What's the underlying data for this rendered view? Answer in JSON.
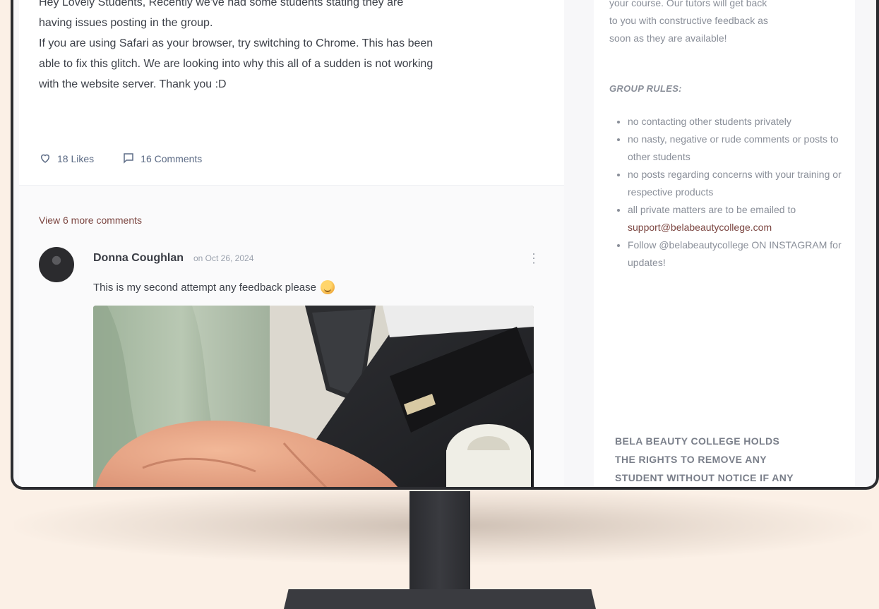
{
  "post": {
    "lines": [
      "Hey Lovely Students, Recently we've had some students stating they are",
      "having issues posting in the group.",
      "If you are using Safari as your browser, try switching to Chrome. This has been",
      "able to fix this glitch. We are looking into why this all of a sudden is not working",
      "with the website server. Thank you :D"
    ],
    "likes_label": "18 Likes",
    "comments_label": "16 Comments"
  },
  "comments": {
    "view_more_label": "View 6 more comments",
    "items": [
      {
        "author": "Donna Coughlan",
        "date": "on Oct 26, 2024",
        "text": "This is my second attempt any feedback please"
      }
    ]
  },
  "sidebar": {
    "intro_lines": [
      "your course. Our tutors will get back",
      "to you with constructive feedback as",
      "soon as they are available!"
    ],
    "rules_heading": "GROUP RULES:",
    "rules": [
      "no contacting other students privately",
      "no nasty, negative or rude comments or posts to other students",
      "no posts regarding concerns with your training or respective products",
      "all private matters are to be emailed to",
      "Follow @belabeautycollege ON INSTAGRAM for updates!"
    ],
    "support_email": "support@belabeautycollege.com",
    "notice_lines": [
      "BELA BEAUTY COLLEGE HOLDS",
      "THE RIGHTS TO REMOVE ANY",
      "STUDENT WITHOUT NOTICE IF ANY"
    ]
  },
  "colors": {
    "background": "#fbf0e6",
    "accent_link": "#7b4540",
    "meta_text": "#5c6b85"
  },
  "icons": [
    "heart-icon",
    "comment-icon",
    "kebab-menu-icon",
    "smile-emoji-icon"
  ]
}
